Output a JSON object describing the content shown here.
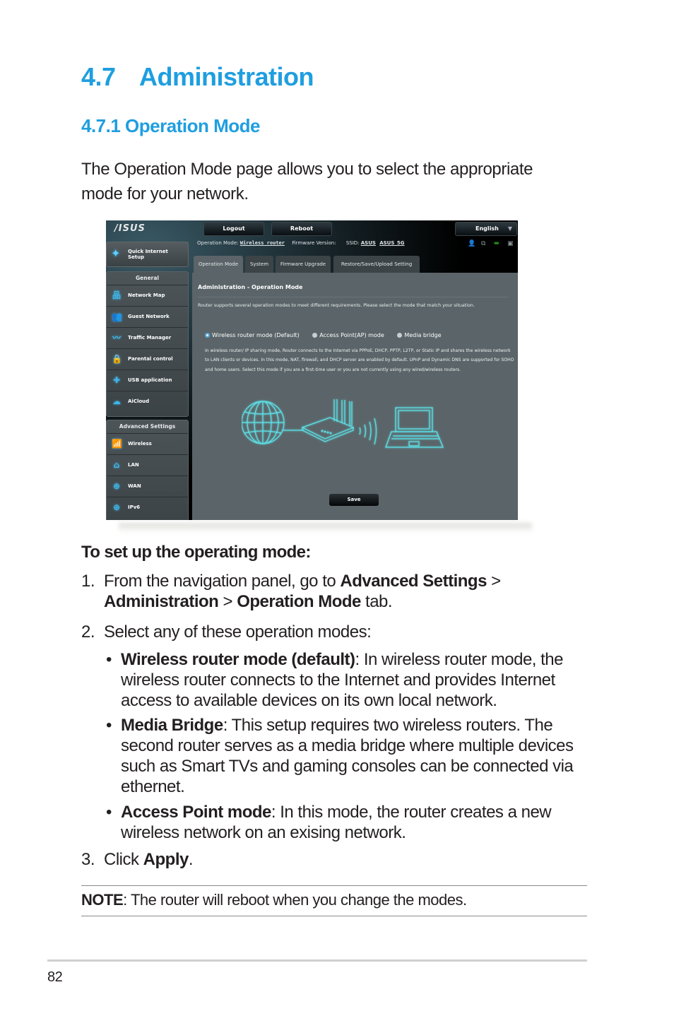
{
  "heading": {
    "number": "4.7",
    "title": "Administration"
  },
  "subheading": "4.7.1 Operation Mode",
  "intro": "The Operation Mode page allows you to select the appropriate mode for your network.",
  "router_ui": {
    "logo": "/ISUS",
    "top_buttons": {
      "logout": "Logout",
      "reboot": "Reboot",
      "language": "English"
    },
    "quick_setup": "Quick Internet Setup",
    "status": {
      "op_mode_label": "Operation Mode:",
      "op_mode_value": "Wireless router",
      "firmware_label": "Firmware Version:",
      "ssid_label": "SSID:",
      "ssid_1": "ASUS",
      "ssid_2": "ASUS_5G"
    },
    "sidebar": {
      "general_header": "General",
      "general_items": [
        {
          "label": "Network Map",
          "icon": "network-map-icon"
        },
        {
          "label": "Guest Network",
          "icon": "guest-network-icon"
        },
        {
          "label": "Traffic Manager",
          "icon": "traffic-manager-icon"
        },
        {
          "label": "Parental control",
          "icon": "lock-icon"
        },
        {
          "label": "USB application",
          "icon": "puzzle-icon"
        },
        {
          "label": "AiCloud",
          "icon": "cloud-icon"
        }
      ],
      "advanced_header": "Advanced Settings",
      "advanced_items": [
        {
          "label": "Wireless",
          "icon": "wifi-icon"
        },
        {
          "label": "LAN",
          "icon": "home-icon"
        },
        {
          "label": "WAN",
          "icon": "globe-icon"
        },
        {
          "label": "IPv6",
          "icon": "ipv6-globe-icon"
        }
      ]
    },
    "tabs": [
      "Operation Mode",
      "System",
      "Firmware Upgrade",
      "Restore/Save/Upload Setting"
    ],
    "active_tab": "Operation Mode",
    "panel_title": "Administration - Operation Mode",
    "panel_description": "Router supports several operation modes to meet different requirements. Please select the mode that match your situation.",
    "modes": [
      {
        "label": "Wireless router mode (Default)",
        "selected": true
      },
      {
        "label": "Access Point(AP) mode",
        "selected": false
      },
      {
        "label": "Media bridge",
        "selected": false
      }
    ],
    "mode_description": "In wireless router/ IP sharing mode, Router connects to the Internet via PPPoE, DHCP, PPTP, L2TP, or Static IP and shares the wireless network to LAN clients or devices. In this mode, NAT, firewall, and DHCP server are enabled by default. UPnP and Dynamic DNS are supported for SOHO and home users. Select this mode if you are a first-time user or you are not currently using any wired/wireless routers.",
    "save_label": "Save",
    "colors": {
      "accent_glow": "#5ce0e6",
      "icon_blue": "#3fb6e8",
      "status_green": "#35d12f"
    }
  },
  "steps_heading": "To set up the operating mode:",
  "steps": {
    "s1": {
      "num": "1.",
      "a": "From the navigation panel, go to ",
      "b1": "Advanced Settings",
      "c": " > ",
      "b2": "Administration",
      "d": " > ",
      "b3": "Operation Mode",
      "e": " tab."
    },
    "s2": {
      "num": "2.",
      "text": "Select any of these operation modes:"
    },
    "s3": {
      "num": "3.",
      "a": "Click ",
      "b": "Apply",
      "c": "."
    }
  },
  "bullets": [
    {
      "bold": "Wireless router mode (default)",
      "text": ": In wireless router mode, the wireless router connects to the Internet and provides Internet access to available devices on its own local network."
    },
    {
      "bold": "Media Bridge",
      "text": ": This setup requires two wireless routers. The second router serves as a media bridge where multiple devices such as Smart TVs and gaming consoles can be connected via ethernet."
    },
    {
      "bold": "Access Point mode",
      "text": ": In this mode, the router creates a new wireless network on an exising network."
    }
  ],
  "bullet_char": "•",
  "note": {
    "label": "NOTE",
    "text": ":  The router will reboot when you change the modes."
  },
  "page_number": "82",
  "colors": {
    "heading_blue": "#1f9ee0",
    "body_text": "#231f20"
  }
}
